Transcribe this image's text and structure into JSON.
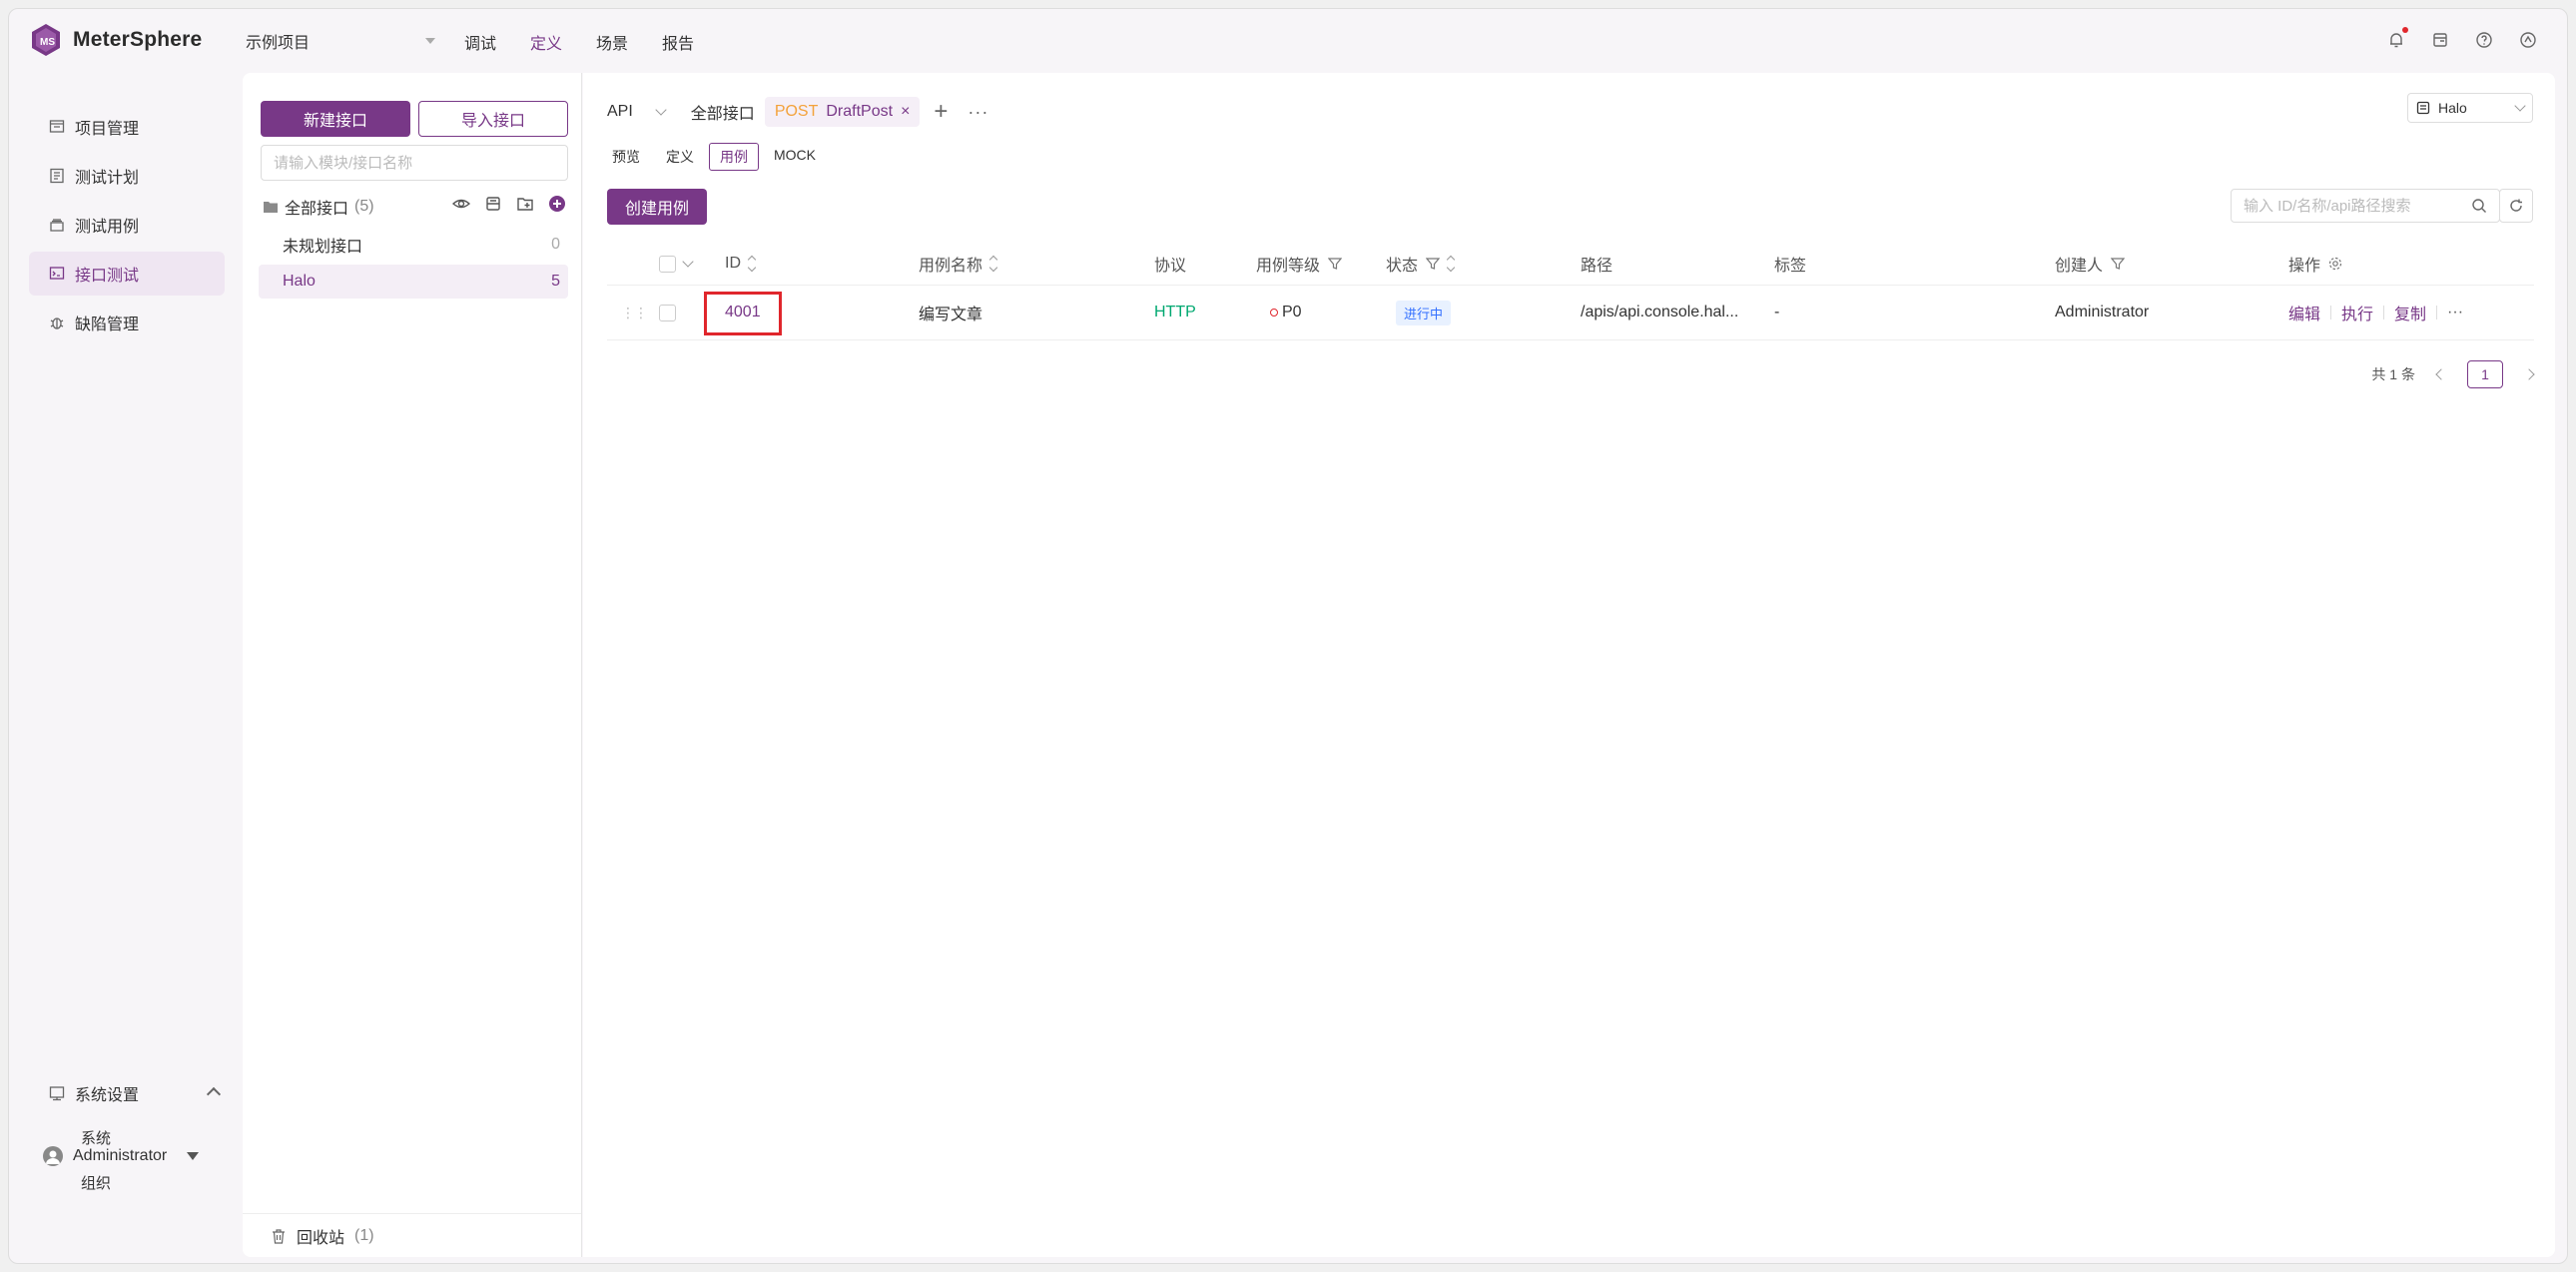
{
  "app": {
    "name": "MeterSphere",
    "brand_color": "#783887"
  },
  "header": {
    "project": "示例项目",
    "nav": [
      {
        "label": "调试",
        "active": false
      },
      {
        "label": "定义",
        "active": true
      },
      {
        "label": "场景",
        "active": false
      },
      {
        "label": "报告",
        "active": false
      }
    ],
    "icons": [
      "bell-icon",
      "task-icon",
      "help-icon",
      "settings-icon"
    ]
  },
  "sidebar": {
    "items": [
      {
        "label": "项目管理",
        "icon": "project-icon"
      },
      {
        "label": "测试计划",
        "icon": "test-plan-icon"
      },
      {
        "label": "测试用例",
        "icon": "test-case-icon"
      },
      {
        "label": "接口测试",
        "icon": "api-test-icon",
        "active": true
      },
      {
        "label": "缺陷管理",
        "icon": "bug-icon"
      }
    ],
    "system": {
      "label": "系统设置",
      "subs": [
        "系统",
        "组织"
      ]
    },
    "user": "Administrator"
  },
  "modules": {
    "new_api": "新建接口",
    "import_api": "导入接口",
    "search_placeholder": "请输入模块/接口名称",
    "root_label": "全部接口",
    "root_count": "(5)",
    "items": [
      {
        "label": "未规划接口",
        "count": "0"
      },
      {
        "label": "Halo",
        "count": "5"
      }
    ],
    "recycle_label": "回收站",
    "recycle_count": "(1)"
  },
  "main": {
    "api_select": "API",
    "tabs": [
      {
        "label": "全部接口"
      },
      {
        "method": "POST",
        "name": "DraftPost",
        "close": "×"
      }
    ],
    "more": "···",
    "environment": "Halo",
    "segments": [
      {
        "label": "预览"
      },
      {
        "label": "定义"
      },
      {
        "label": "用例",
        "active": true
      },
      {
        "label": "MOCK"
      }
    ],
    "create_case": "创建用例",
    "search_placeholder": "输入 ID/名称/api路径搜索"
  },
  "table": {
    "headers": {
      "id": "ID",
      "name": "用例名称",
      "protocol": "协议",
      "priority": "用例等级",
      "status": "状态",
      "path": "路径",
      "tags": "标签",
      "creator": "创建人",
      "ops": "操作"
    },
    "rows": [
      {
        "id": "4001",
        "name": "编写文章",
        "protocol": "HTTP",
        "priority": "P0",
        "status": "进行中",
        "path": "/apis/api.console.hal...",
        "tags": "-",
        "creator": "Administrator",
        "actions": {
          "edit": "编辑",
          "run": "执行",
          "copy": "复制",
          "more": "···"
        }
      }
    ],
    "total": "共 1 条",
    "page": "1"
  }
}
